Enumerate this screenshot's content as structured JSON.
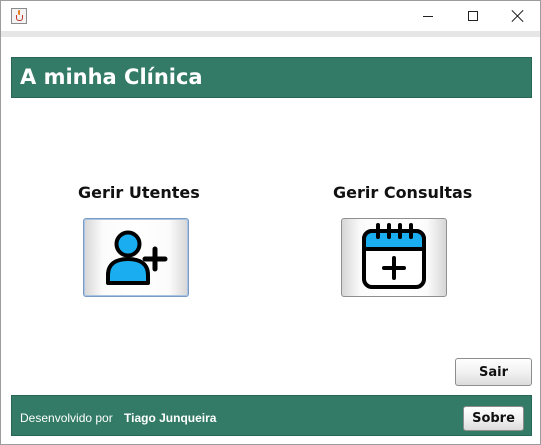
{
  "window": {
    "icon": "java-cup-icon",
    "controls": {
      "minimize": "minimize-icon",
      "maximize": "maximize-icon",
      "close": "close-icon"
    }
  },
  "header": {
    "title": "A minha Clínica"
  },
  "main": {
    "utentes": {
      "label": "Gerir Utentes",
      "icon": "add-user-icon"
    },
    "consultas": {
      "label": "Gerir Consultas",
      "icon": "calendar-add-icon"
    },
    "exit_label": "Sair"
  },
  "footer": {
    "developed_by": "Desenvolvido por",
    "author": "Tiago Junqueira",
    "about_label": "Sobre"
  },
  "colors": {
    "accent_green": "#337b66",
    "icon_blue": "#1aaef0",
    "icon_stroke": "#000000"
  }
}
